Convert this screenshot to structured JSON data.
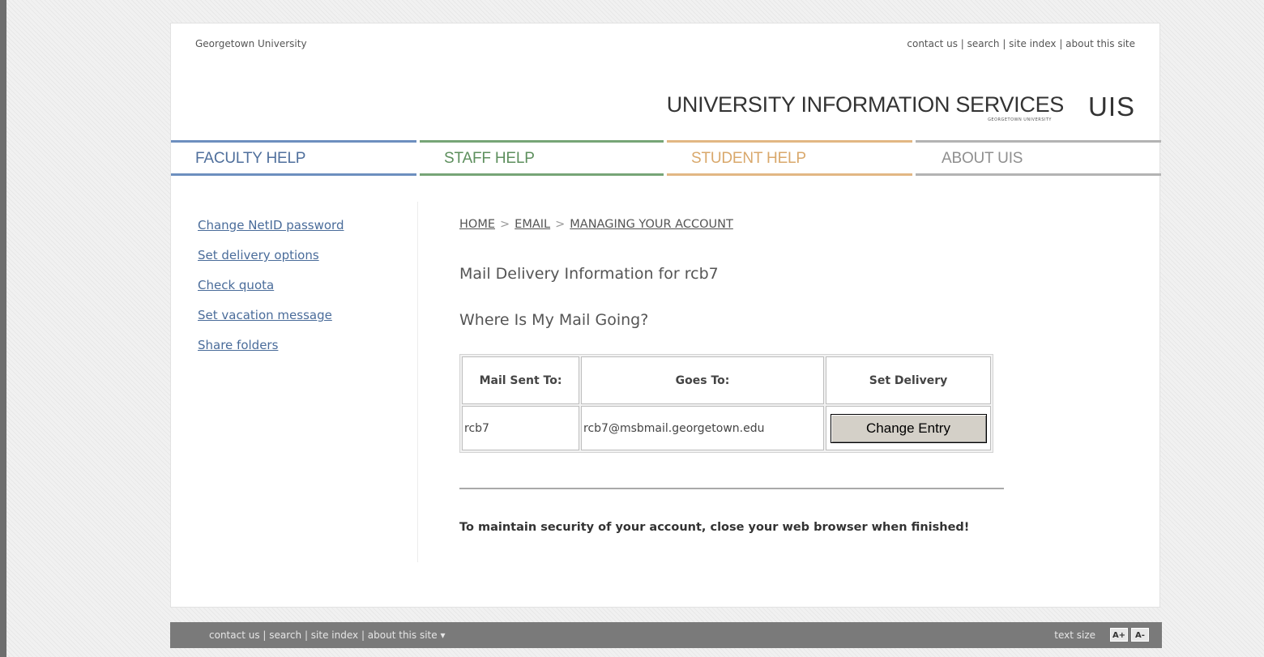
{
  "header": {
    "org_name": "Georgetown University",
    "top_links": [
      "contact us",
      "search",
      "site index",
      "about this site"
    ],
    "banner_title": "UNIVERSITY INFORMATION SERVICES",
    "banner_subtitle": "GEORGETOWN UNIVERSITY",
    "banner_logo": "UIS"
  },
  "nav": {
    "tabs": [
      {
        "label": "FACULTY HELP",
        "color": "#6d8fbf"
      },
      {
        "label": "STAFF HELP",
        "color": "#77a577"
      },
      {
        "label": "STUDENT HELP",
        "color": "#e2b784"
      },
      {
        "label": "ABOUT UIS",
        "color": "#a9a9a9"
      }
    ]
  },
  "sidebar": {
    "items": [
      "Change NetID password",
      "Set delivery options",
      "Check quota",
      "Set vacation message",
      "Share folders"
    ]
  },
  "breadcrumb": [
    "HOME",
    "EMAIL",
    "MANAGING YOUR ACCOUNT"
  ],
  "main": {
    "title": "Mail Delivery Information for rcb7",
    "subtitle": "Where Is My Mail Going?",
    "table": {
      "headers": [
        "Mail Sent To:",
        "Goes To:",
        "Set Delivery"
      ],
      "rows": [
        {
          "sent_to": "rcb7",
          "goes_to": "rcb7@msbmail.georgetown.edu",
          "action_label": "Change Entry"
        }
      ]
    },
    "notice": "To maintain security of your account, close your web browser when finished!"
  },
  "footer": {
    "links": [
      "contact us",
      "search",
      "site index",
      "about this site"
    ],
    "textsize_label": "text size",
    "increase_label": "A+",
    "decrease_label": "A-"
  }
}
